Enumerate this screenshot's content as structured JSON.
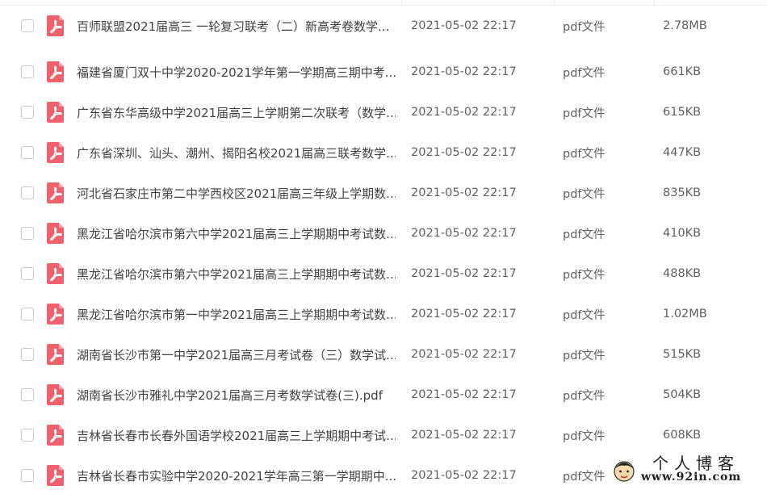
{
  "files": [
    {
      "name": "百师联盟2021届高三 一轮复习联考（二）新高考卷数学...",
      "date": "2021-05-02 22:17",
      "type": "pdf文件",
      "size": "2.78MB"
    },
    {
      "name": "福建省厦门双十中学2020-2021学年第一学期高三期中考...",
      "date": "2021-05-02 22:17",
      "type": "pdf文件",
      "size": "661KB"
    },
    {
      "name": "广东省东华高级中学2021届高三上学期第二次联考（数学...",
      "date": "2021-05-02 22:17",
      "type": "pdf文件",
      "size": "615KB"
    },
    {
      "name": "广东省深圳、汕头、潮州、揭阳名校2021届高三联考数学...",
      "date": "2021-05-02 22:17",
      "type": "pdf文件",
      "size": "447KB"
    },
    {
      "name": "河北省石家庄市第二中学西校区2021届高三年级上学期数...",
      "date": "2021-05-02 22:17",
      "type": "pdf文件",
      "size": "835KB"
    },
    {
      "name": "黑龙江省哈尔滨市第六中学2021届高三上学期期中考试数...",
      "date": "2021-05-02 22:17",
      "type": "pdf文件",
      "size": "410KB"
    },
    {
      "name": "黑龙江省哈尔滨市第六中学2021届高三上学期期中考试数...",
      "date": "2021-05-02 22:17",
      "type": "pdf文件",
      "size": "488KB"
    },
    {
      "name": "黑龙江省哈尔滨市第一中学2021届高三上学期期中考试数...",
      "date": "2021-05-02 22:17",
      "type": "pdf文件",
      "size": "1.02MB"
    },
    {
      "name": "湖南省长沙市第一中学2021届高三月考试卷（三）数学试...",
      "date": "2021-05-02 22:17",
      "type": "pdf文件",
      "size": "515KB"
    },
    {
      "name": "湖南省长沙市雅礼中学2021届高三月考数学试卷(三).pdf",
      "date": "2021-05-02 22:17",
      "type": "pdf文件",
      "size": "504KB"
    },
    {
      "name": "吉林省长春市长春外国语学校2021届高三上学期期中考试...",
      "date": "2021-05-02 22:17",
      "type": "pdf文件",
      "size": "608KB"
    },
    {
      "name": "吉林省长春市实验中学2020-2021学年高三第一学期期中...",
      "date": "2021-05-02 22:17",
      "type": "pdf文件",
      "size": ""
    }
  ],
  "icons": {
    "file": "pdf-icon",
    "checkbox": "checkbox-icon"
  },
  "colors": {
    "pdf_icon": "#f0616f",
    "text": "#424242",
    "meta_text": "#616161"
  },
  "watermark": {
    "title": "个人博客",
    "url": "www.92in.com"
  }
}
